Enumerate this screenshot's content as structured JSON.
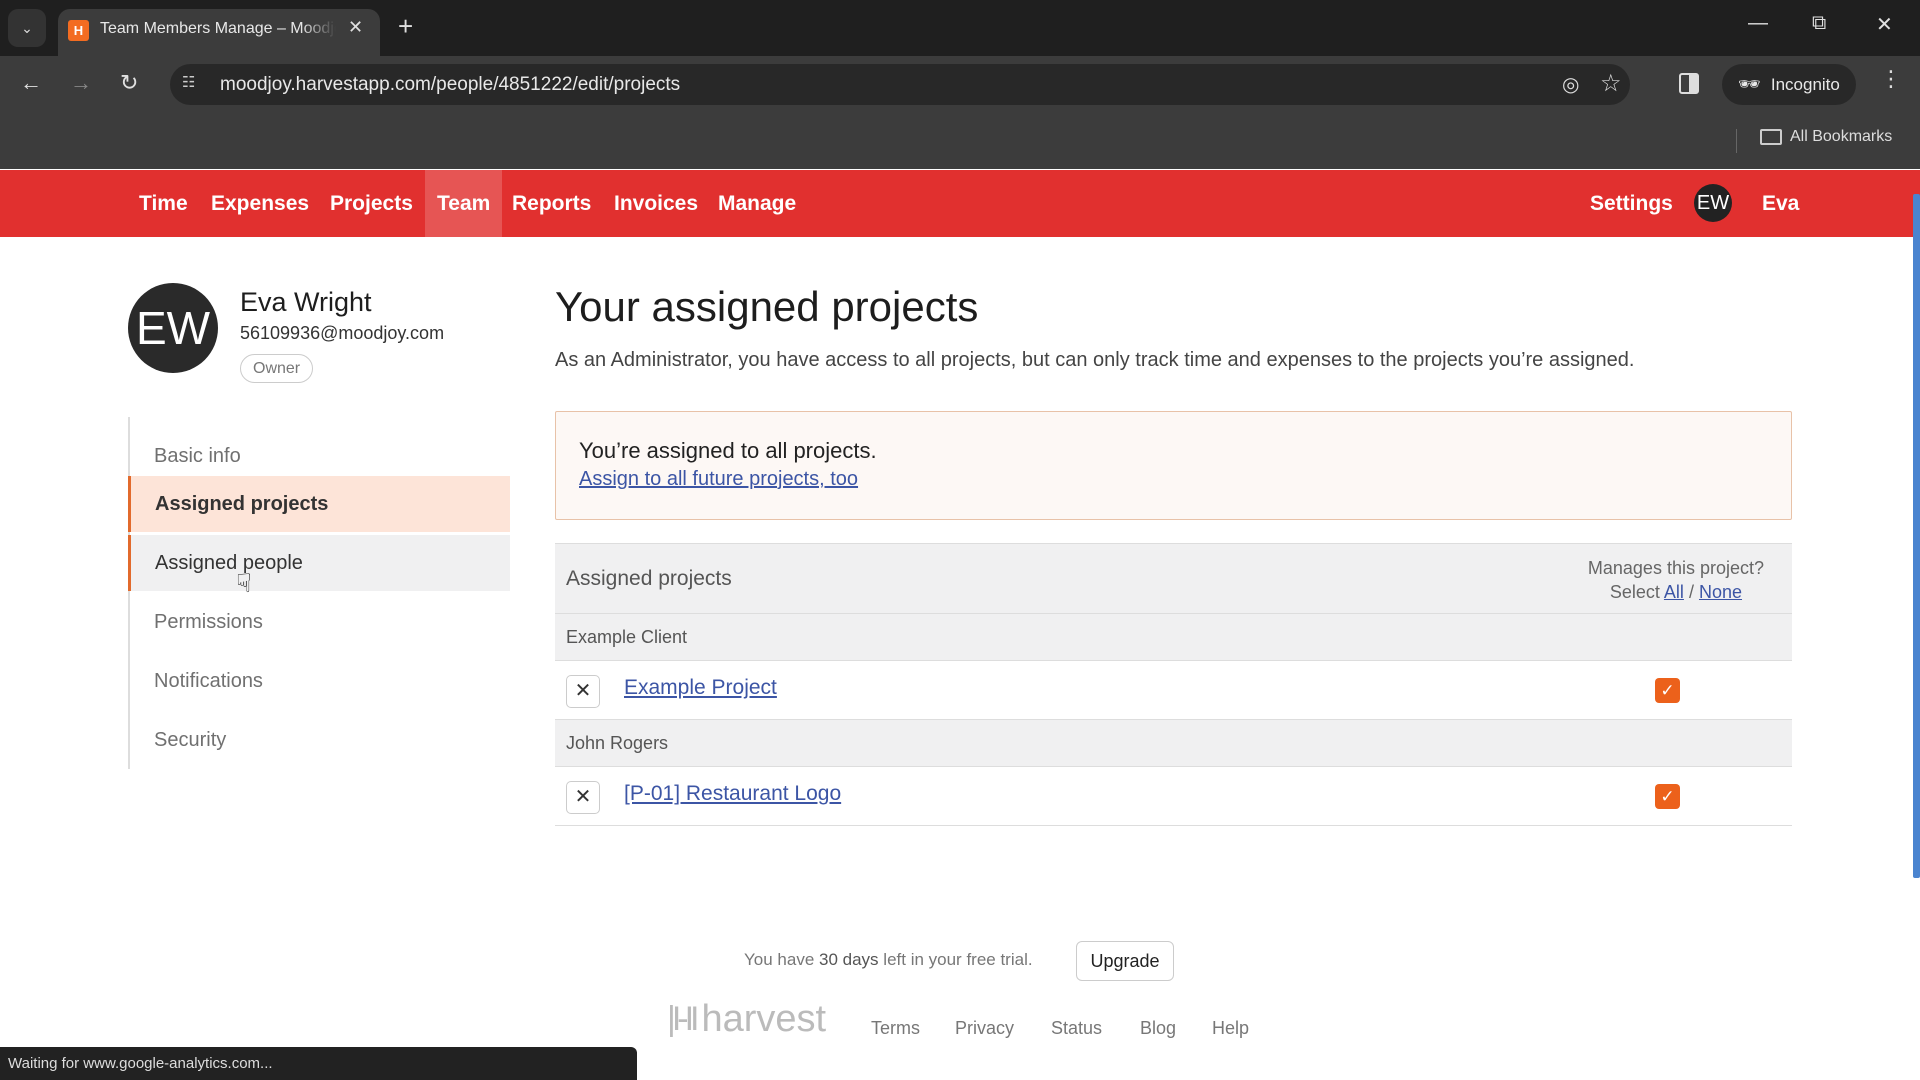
{
  "browser": {
    "tab_title": "Team Members Manage – Moodjoy – Harvest",
    "new_tab_icon": "plus-icon",
    "url": "moodjoy.harvestapp.com/people/4851222/edit/projects",
    "incognito_label": "Incognito",
    "bookmarks_label": "All Bookmarks",
    "status_text": "Waiting for www.google-analytics.com..."
  },
  "nav": {
    "items": [
      {
        "label": "Time"
      },
      {
        "label": "Expenses"
      },
      {
        "label": "Projects"
      },
      {
        "label": "Team",
        "active": true
      },
      {
        "label": "Reports"
      },
      {
        "label": "Invoices"
      },
      {
        "label": "Manage"
      }
    ],
    "settings_label": "Settings",
    "user_initials": "EW",
    "user_name": "Eva",
    "brand_color": "#e1302f"
  },
  "profile": {
    "initials": "EW",
    "name": "Eva Wright",
    "email": "56109936@moodjoy.com",
    "role": "Owner"
  },
  "side_menu": {
    "items": [
      {
        "label": "Basic info"
      },
      {
        "label": "Assigned projects",
        "active": true
      },
      {
        "label": "Assigned people",
        "hover": true
      },
      {
        "label": "Permissions"
      },
      {
        "label": "Notifications"
      },
      {
        "label": "Security"
      }
    ]
  },
  "main": {
    "title": "Your assigned projects",
    "description": "As an Administrator, you have access to all projects, but can only track time and expenses to the projects you’re assigned.",
    "notice": {
      "title": "You’re assigned to all projects.",
      "link": "Assign to all future projects, too"
    },
    "table": {
      "header_label": "Assigned projects",
      "manages_label": "Manages this project?",
      "select_label": "Select",
      "select_all": "All",
      "separator": "/",
      "select_none": "None",
      "groups": [
        {
          "client": "Example Client",
          "projects": [
            {
              "name": "Example Project",
              "manages": true
            }
          ]
        },
        {
          "client": "John Rogers",
          "projects": [
            {
              "name": "[P-01] Restaurant Logo",
              "manages": true
            }
          ]
        }
      ]
    }
  },
  "footer": {
    "trial_prefix": "You have",
    "trial_days": "30 days",
    "trial_suffix": "left in your free trial.",
    "upgrade_label": "Upgrade",
    "logo_text": "harvest",
    "links": [
      "Terms",
      "Privacy",
      "Status",
      "Blog",
      "Help"
    ]
  }
}
